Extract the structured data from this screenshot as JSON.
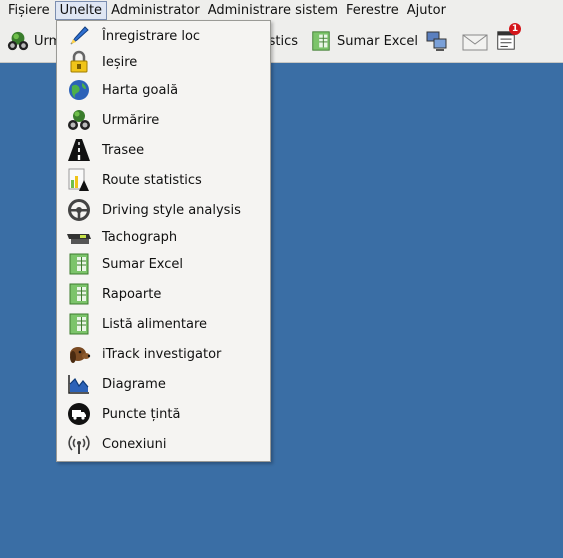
{
  "menubar": {
    "items": [
      {
        "label": "Fișiere"
      },
      {
        "label": "Unelte"
      },
      {
        "label": "Administrator"
      },
      {
        "label": "Administrare sistem"
      },
      {
        "label": "Ferestre"
      },
      {
        "label": "Ajutor"
      }
    ]
  },
  "toolbar": {
    "tracking_label": "Urm",
    "statistics_label": "istics",
    "excel_label": "Sumar Excel",
    "notification_count": "1"
  },
  "dropdown": {
    "items": [
      {
        "label": "Înregistrare loc",
        "icon": "pen-icon"
      },
      {
        "label": "Ieșire",
        "icon": "lock-icon"
      },
      {
        "label": "Harta goală",
        "icon": "globe-icon"
      },
      {
        "label": "Urmărire",
        "icon": "binoculars-icon"
      },
      {
        "label": "Trasee",
        "icon": "road-icon"
      },
      {
        "label": "Route statistics",
        "icon": "stats-icon"
      },
      {
        "label": "Driving style analysis",
        "icon": "steering-wheel-icon"
      },
      {
        "label": "Tachograph",
        "icon": "tachograph-icon"
      },
      {
        "label": "Sumar Excel",
        "icon": "excel-icon"
      },
      {
        "label": "Rapoarte",
        "icon": "report-icon"
      },
      {
        "label": "Listă alimentare",
        "icon": "fuel-list-icon"
      },
      {
        "label": "iTrack investigator",
        "icon": "dog-icon"
      },
      {
        "label": "Diagrame",
        "icon": "chart-icon"
      },
      {
        "label": "Puncte țintă",
        "icon": "truck-icon"
      },
      {
        "label": "Conexiuni",
        "icon": "antenna-icon"
      }
    ]
  },
  "colors": {
    "desktop": "#3a6ea5",
    "menu_bg": "#f5f4f2",
    "bar_bg": "#eeeeec",
    "active_menu": "#dfe6f3"
  }
}
